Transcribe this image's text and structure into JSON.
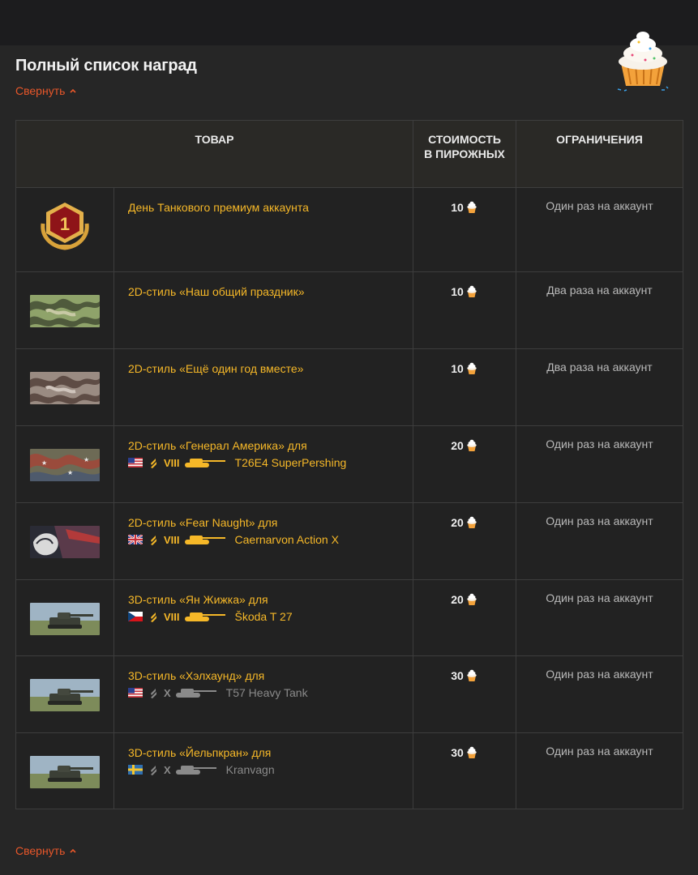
{
  "page": {
    "title": "Полный список наград",
    "collapse_label": "Свернуть"
  },
  "table": {
    "headers": [
      "ТОВАР",
      "СТОИМОСТЬ В ПИРОЖНЫХ",
      "ОГРАНИЧЕНИЯ"
    ],
    "rows": [
      {
        "image": "medal-premium-icon",
        "name": "День Танкового премиум аккаунта",
        "cost": "10",
        "limit": "Один раз на аккаунт"
      },
      {
        "image": "camo-green-thumb",
        "name": "2D-стиль «Наш общий праздник»",
        "cost": "10",
        "limit": "Два раза на аккаунт"
      },
      {
        "image": "camo-brown-thumb",
        "name": "2D-стиль «Ещё один год вместе»",
        "cost": "10",
        "limit": "Два раза на аккаунт"
      },
      {
        "image": "camo-america-thumb",
        "name": "2D-стиль «Генерал Америка» для",
        "flag": "usa-flag-icon",
        "tier": "VIII",
        "tank": "T26E4 SuperPershing",
        "tank_color": "gold",
        "cost": "20",
        "limit": "Один раз на аккаунт"
      },
      {
        "image": "fear-naught-thumb",
        "name": "2D-стиль «Fear Naught» для",
        "flag": "uk-flag-icon",
        "tier": "VIII",
        "tank": "Caernarvon Action X",
        "tank_color": "gold",
        "cost": "20",
        "limit": "Один раз на аккаунт"
      },
      {
        "image": "tank-3d-thumb",
        "name": "3D-стиль «Ян Жижка» для",
        "flag": "czech-flag-icon",
        "tier": "VIII",
        "tank": "Škoda T 27",
        "tank_color": "gold",
        "cost": "20",
        "limit": "Один раз на аккаунт"
      },
      {
        "image": "tank-3d-thumb",
        "name": "3D-стиль «Хэлхаунд» для",
        "flag": "usa-flag-icon",
        "tier": "X",
        "tank": "T57 Heavy Tank",
        "tank_color": "grey",
        "cost": "30",
        "limit": "Один раз на аккаунт"
      },
      {
        "image": "tank-3d-thumb",
        "name": "3D-стиль «Йельпкран» для",
        "flag": "sweden-flag-icon",
        "tier": "X",
        "tank": "Kranvagn",
        "tank_color": "grey",
        "cost": "30",
        "limit": "Один раз на аккаунт"
      }
    ]
  },
  "colors": {
    "accent_orange": "#e8572a",
    "item_gold": "#f6b828",
    "background": "#262626"
  }
}
